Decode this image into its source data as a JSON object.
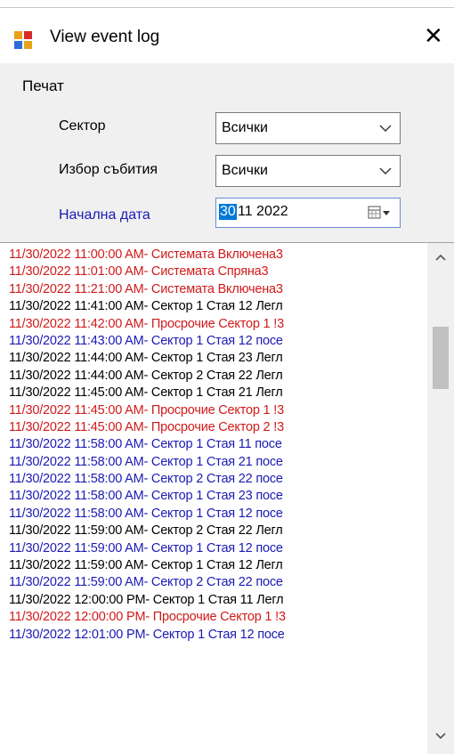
{
  "window": {
    "title": "View event log",
    "close_glyph": "✕"
  },
  "menu": {
    "items": [
      {
        "label": "Печат"
      }
    ]
  },
  "form": {
    "sector_label": "Сектор",
    "sector_value": "Всички",
    "event_label": "Избор събития",
    "event_value": "Всички",
    "start_label": "Начална дата",
    "date_day": "30",
    "date_rest": "11 2022"
  },
  "colors": {
    "red": "#d11a1a",
    "blue": "#1a1ab5",
    "black": "#000000",
    "accent": "#0078d7"
  },
  "log": [
    {
      "text": "11/30/2022 11:00:00 AM- Системата Включена3",
      "color": "#d11a1a"
    },
    {
      "text": "11/30/2022 11:01:00 AM- Системата Спряна3",
      "color": "#d11a1a"
    },
    {
      "text": "11/30/2022 11:21:00 AM- Системата Включена3",
      "color": "#d11a1a"
    },
    {
      "text": "11/30/2022 11:41:00 AM- Сектор 1 Стая 12 Легл",
      "color": "#000000"
    },
    {
      "text": "11/30/2022 11:42:00 AM- Просрочие Сектор 1 !3",
      "color": "#d11a1a"
    },
    {
      "text": "11/30/2022 11:43:00 AM- Сектор 1 Стая 12 посе",
      "color": "#1a1ab5"
    },
    {
      "text": "11/30/2022 11:44:00 AM- Сектор 1 Стая 23 Легл",
      "color": "#000000"
    },
    {
      "text": "11/30/2022 11:44:00 AM- Сектор 2 Стая 22 Легл",
      "color": "#000000"
    },
    {
      "text": "11/30/2022 11:45:00 AM- Сектор 1 Стая 21 Легл",
      "color": "#000000"
    },
    {
      "text": "11/30/2022 11:45:00 AM- Просрочие Сектор 1 !3",
      "color": "#d11a1a"
    },
    {
      "text": "11/30/2022 11:45:00 AM- Просрочие Сектор 2 !3",
      "color": "#d11a1a"
    },
    {
      "text": "11/30/2022 11:58:00 AM- Сектор 1 Стая 11 посе",
      "color": "#1a1ab5"
    },
    {
      "text": "11/30/2022 11:58:00 AM- Сектор 1 Стая 21 посе",
      "color": "#1a1ab5"
    },
    {
      "text": "11/30/2022 11:58:00 AM- Сектор 2 Стая 22 посе",
      "color": "#1a1ab5"
    },
    {
      "text": "11/30/2022 11:58:00 AM- Сектор 1 Стая 23 посе",
      "color": "#1a1ab5"
    },
    {
      "text": "11/30/2022 11:58:00 AM- Сектор 1 Стая 12 посе",
      "color": "#1a1ab5"
    },
    {
      "text": "11/30/2022 11:59:00 AM- Сектор 2 Стая 22 Легл",
      "color": "#000000"
    },
    {
      "text": "11/30/2022 11:59:00 AM- Сектор 1 Стая 12 посе",
      "color": "#1a1ab5"
    },
    {
      "text": "11/30/2022 11:59:00 AM- Сектор 1 Стая 12 Легл",
      "color": "#000000"
    },
    {
      "text": "11/30/2022 11:59:00 AM- Сектор 2 Стая 22 посе",
      "color": "#1a1ab5"
    },
    {
      "text": "11/30/2022 12:00:00 PM- Сектор 1 Стая 11 Легл",
      "color": "#000000"
    },
    {
      "text": "11/30/2022 12:00:00 PM- Просрочие Сектор 1 !3",
      "color": "#d11a1a"
    },
    {
      "text": "11/30/2022 12:01:00 PM- Сектор 1 Стая 12 посе",
      "color": "#1a1ab5"
    }
  ]
}
